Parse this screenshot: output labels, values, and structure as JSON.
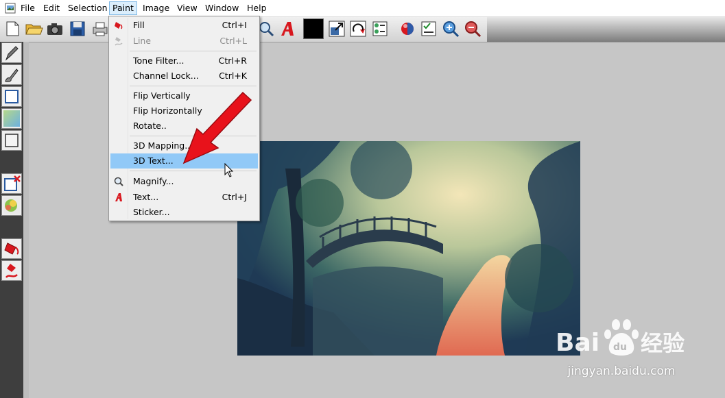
{
  "menubar": {
    "items": [
      {
        "label": "File"
      },
      {
        "label": "Edit"
      },
      {
        "label": "Selection"
      },
      {
        "label": "Paint"
      },
      {
        "label": "Image"
      },
      {
        "label": "View"
      },
      {
        "label": "Window"
      },
      {
        "label": "Help"
      }
    ],
    "active": "Paint"
  },
  "paint_menu": {
    "items": [
      {
        "label": "Fill",
        "shortcut": "Ctrl+I",
        "icon": "fill-bucket-icon",
        "enabled": true
      },
      {
        "label": "Line",
        "shortcut": "Ctrl+L",
        "icon": "line-pen-icon",
        "enabled": false
      },
      {
        "label": "Tone Filter...",
        "shortcut": "Ctrl+R",
        "enabled": true
      },
      {
        "label": "Channel Lock...",
        "shortcut": "Ctrl+K",
        "enabled": true
      },
      {
        "label": "Flip Vertically",
        "shortcut": "",
        "enabled": true
      },
      {
        "label": "Flip Horizontally",
        "shortcut": "",
        "enabled": true
      },
      {
        "label": "Rotate..",
        "shortcut": "",
        "enabled": true
      },
      {
        "label": "3D Mapping...",
        "shortcut": "",
        "enabled": true
      },
      {
        "label": "3D Text...",
        "shortcut": "",
        "enabled": true,
        "highlighted": true
      },
      {
        "label": "Magnify...",
        "shortcut": "",
        "icon": "magnifier-icon",
        "enabled": true
      },
      {
        "label": "Text...",
        "shortcut": "Ctrl+J",
        "icon": "text-a-icon",
        "enabled": true
      },
      {
        "label": "Sticker...",
        "shortcut": "",
        "enabled": true
      }
    ]
  },
  "toolbar": {
    "icons": [
      "new-document-icon",
      "open-folder-icon",
      "camera-icon",
      "save-icon",
      "print-icon",
      "zoom-icon",
      "text-a-icon",
      "color-swatch-icon",
      "resize-icon",
      "rotate-icon",
      "layers-icon",
      "sticker-icon",
      "color-ball-icon",
      "checklist-icon",
      "zoom-in-icon",
      "zoom-out-icon"
    ],
    "color_swatch": "#000000"
  },
  "left_tools": {
    "icons": [
      "pen-icon",
      "brush-icon",
      "rectangle-select-icon",
      "gradient-icon",
      "rectangle-icon",
      "clear-selection-icon",
      "color-pattern-icon",
      "fill-bucket-icon",
      "line-draw-icon"
    ]
  },
  "watermark": {
    "brand": "Bai 经验",
    "domain": "jingyan.baidu.com"
  },
  "colors": {
    "menu_highlight": "#91c9f7",
    "arrow": "#e8121b",
    "canvas_bg": "#c6c6c6"
  }
}
